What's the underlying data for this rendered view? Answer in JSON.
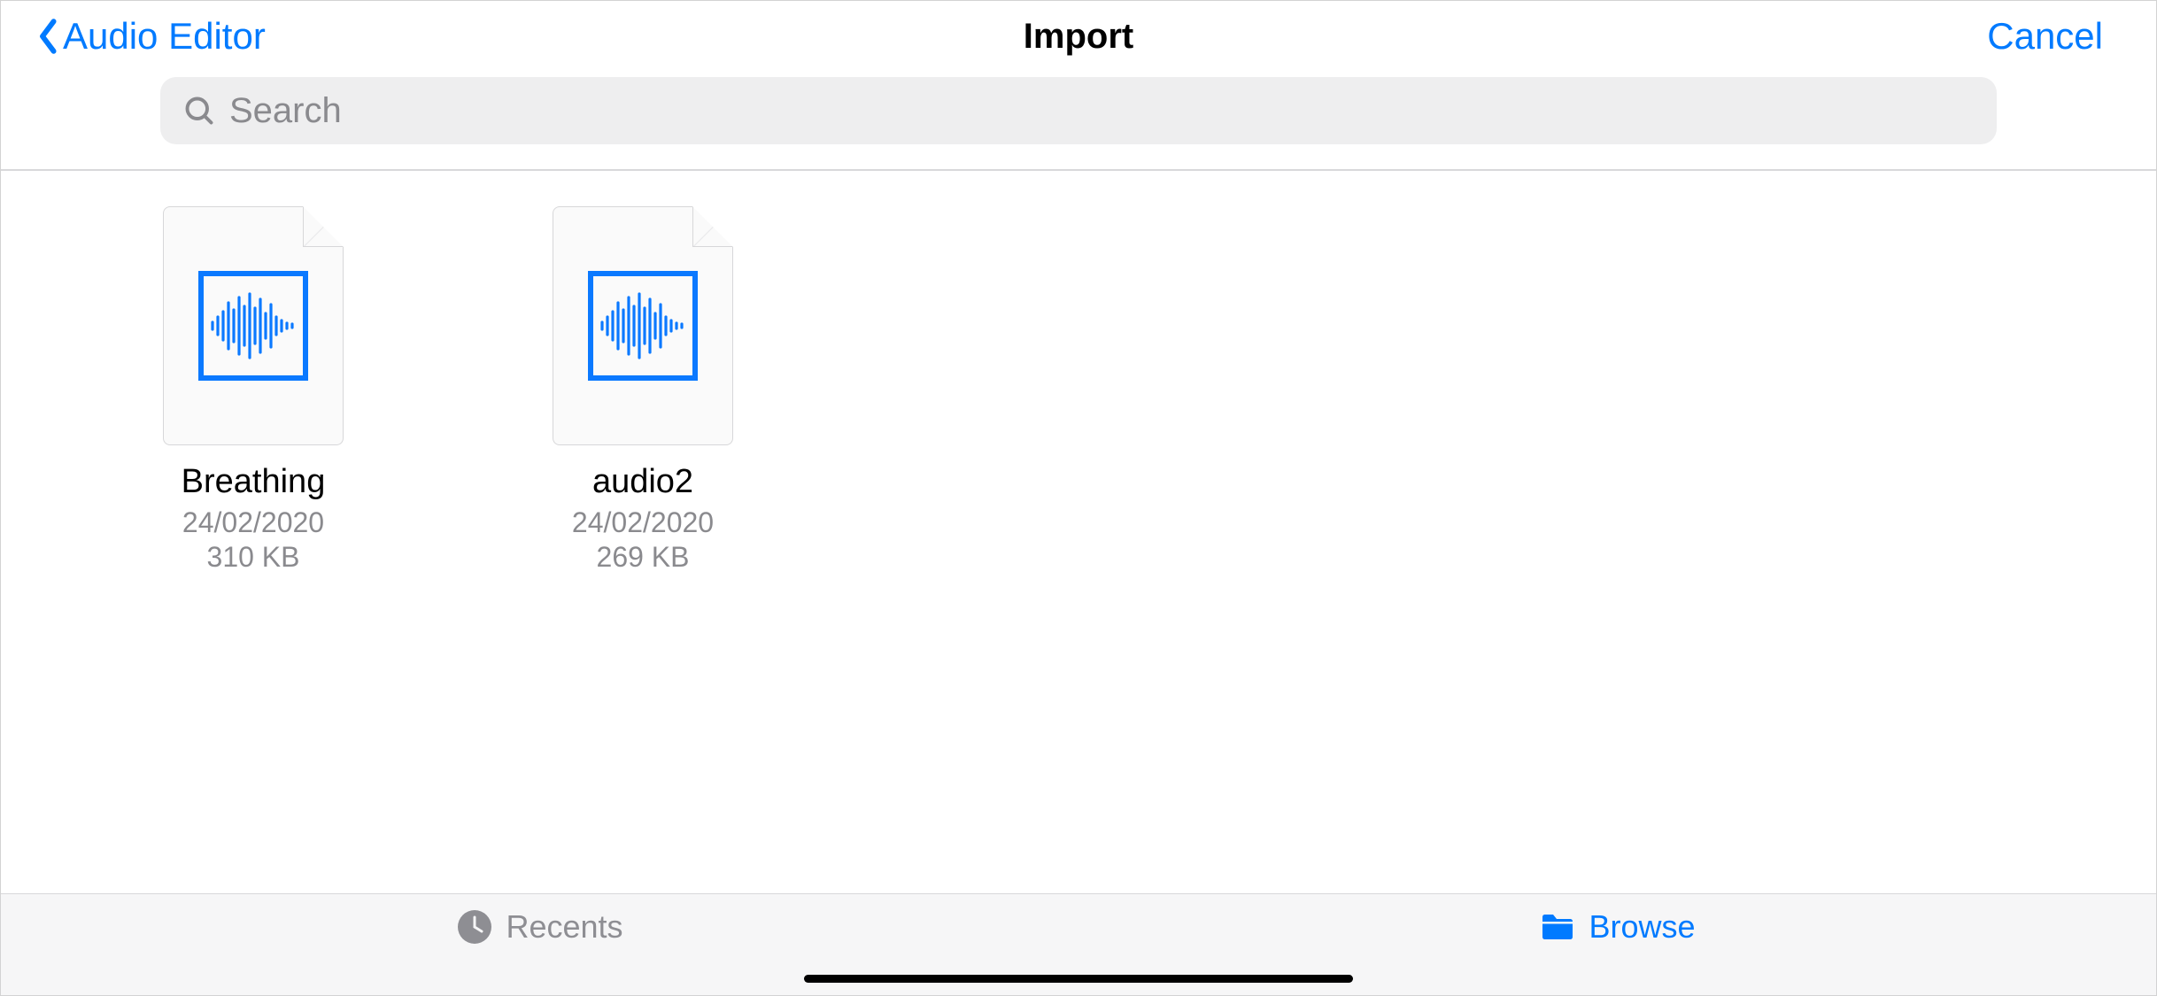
{
  "header": {
    "back_label": "Audio Editor",
    "title": "Import",
    "cancel_label": "Cancel"
  },
  "search": {
    "placeholder": "Search"
  },
  "files": [
    {
      "name": "Breathing",
      "date": "24/02/2020",
      "size": "310 KB"
    },
    {
      "name": "audio2",
      "date": "24/02/2020",
      "size": "269 KB"
    }
  ],
  "tabs": {
    "recents_label": "Recents",
    "browse_label": "Browse"
  }
}
